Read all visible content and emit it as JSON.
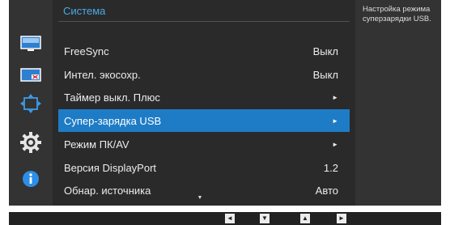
{
  "menu": {
    "title": "Система",
    "rows": [
      {
        "label": "FreeSync",
        "value": "Выкл"
      },
      {
        "label": "Интел. экосохр.",
        "value": "Выкл"
      },
      {
        "label": "Таймер выкл. Плюс",
        "value": "►"
      },
      {
        "label": "Супер-зарядка USB",
        "value": "►"
      },
      {
        "label": "Режим ПК/AV",
        "value": "►"
      },
      {
        "label": "Версия DisplayPort",
        "value": "1.2"
      },
      {
        "label": "Обнар. источника",
        "value": "Авто"
      }
    ],
    "selected_index": 3,
    "scroll_indicator": "▼"
  },
  "help": {
    "text": "Настройка режима суперзарядки USB."
  },
  "sidebar": {
    "icons": [
      "picture-icon",
      "onscreen-display-icon",
      "position-size-icon",
      "system-gear-icon",
      "information-icon"
    ],
    "active_index": 3
  },
  "nav": {
    "buttons": [
      {
        "name": "left",
        "glyph": "◄"
      },
      {
        "name": "down",
        "glyph": "▼"
      },
      {
        "name": "up",
        "glyph": "▲"
      },
      {
        "name": "right",
        "glyph": "►"
      }
    ]
  },
  "colors": {
    "accent": "#1e7cc6",
    "title": "#4aa9e8",
    "panel": "#2a2a2a",
    "background": "#333333"
  }
}
